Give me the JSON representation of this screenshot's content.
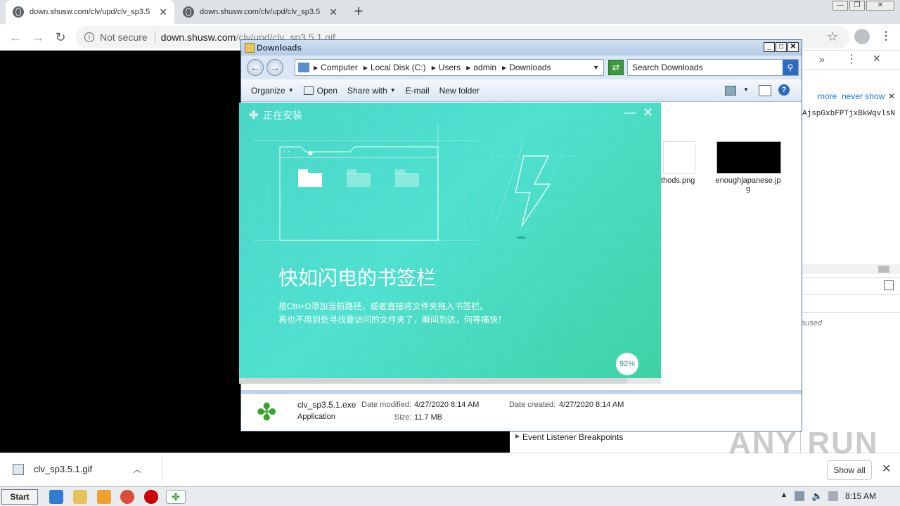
{
  "browser": {
    "tabs": [
      {
        "title": "down.shusw.com/clv/upd/clv_sp3.5",
        "active": true
      },
      {
        "title": "down.shusw.com/clv/upd/clv_sp3.5",
        "active": false
      }
    ],
    "security_label": "Not secure",
    "url_host": "down.shusw.com",
    "url_path": "/clv/upd/clv_sp3.5.1.gif"
  },
  "devtools": {
    "more_label": "more",
    "never_show_label": "never show",
    "code_text": "AjspGxbFPTjxBkWqvlsN",
    "paused_text": "aused",
    "breakpoints_label": "Event Listener Breakpoints"
  },
  "explorer": {
    "title": "Downloads",
    "breadcrumbs": [
      "Computer",
      "Local Disk (C:)",
      "Users",
      "admin",
      "Downloads"
    ],
    "search_placeholder": "Search Downloads",
    "commands": [
      "Organize",
      "Open",
      "Share with",
      "E-mail",
      "New folder"
    ],
    "files": [
      {
        "name": "thods.png"
      },
      {
        "name": "enoughjapanese.jp g"
      }
    ],
    "details": {
      "filename": "clv_sp3.5.1.exe",
      "type": "Application",
      "date_modified_label": "Date modified:",
      "date_modified": "4/27/2020 8:14 AM",
      "date_created_label": "Date created:",
      "date_created": "4/27/2020 8:14 AM",
      "size_label": "Size:",
      "size": "11.7 MB"
    }
  },
  "installer": {
    "title": "正在安装",
    "headline": "快如闪电的书签栏",
    "desc_line1": "按Ctrl+D添加当前路径，或者直接将文件夹拖入书签栏。",
    "desc_line2": "再也不用到处寻找要访问的文件夹了，瞬间到达，何等痛快！",
    "progress_label": "92%",
    "progress_value": 0.92
  },
  "download_shelf": {
    "filename": "clv_sp3.5.1.gif",
    "show_all_label": "Show all"
  },
  "taskbar": {
    "start_label": "Start",
    "clock": "8:15 AM"
  },
  "watermark": "ANY RUN"
}
